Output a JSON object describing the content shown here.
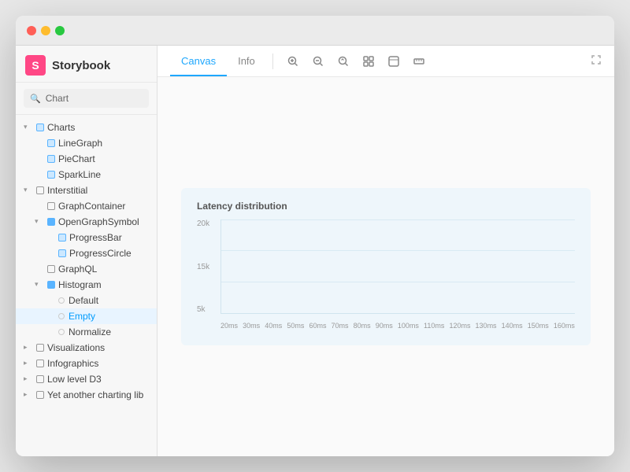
{
  "window": {
    "title": "Storybook"
  },
  "sidebar": {
    "logo_letter": "S",
    "title": "Storybook",
    "search_placeholder": "Chart",
    "items": [
      {
        "id": "charts",
        "label": "Charts",
        "indent": 1,
        "type": "group",
        "expanded": true
      },
      {
        "id": "linegraph",
        "label": "LineGraph",
        "indent": 2,
        "type": "leaf"
      },
      {
        "id": "piechart",
        "label": "PieChart",
        "indent": 2,
        "type": "leaf"
      },
      {
        "id": "sparkline",
        "label": "SparkLine",
        "indent": 2,
        "type": "leaf"
      },
      {
        "id": "interstitial",
        "label": "Interstitial",
        "indent": 1,
        "type": "group",
        "expanded": true
      },
      {
        "id": "graphcontainer",
        "label": "GraphContainer",
        "indent": 2,
        "type": "leaf"
      },
      {
        "id": "opengraphsymbol",
        "label": "OpenGraphSymbol",
        "indent": 2,
        "type": "group",
        "expanded": true
      },
      {
        "id": "progressbar",
        "label": "ProgressBar",
        "indent": 3,
        "type": "leaf"
      },
      {
        "id": "progresscircle",
        "label": "ProgressCircle",
        "indent": 3,
        "type": "leaf"
      },
      {
        "id": "graphql",
        "label": "GraphQL",
        "indent": 2,
        "type": "leaf"
      },
      {
        "id": "histogram",
        "label": "Histogram",
        "indent": 2,
        "type": "group",
        "expanded": true
      },
      {
        "id": "default",
        "label": "Default",
        "indent": 3,
        "type": "story"
      },
      {
        "id": "empty",
        "label": "Empty",
        "indent": 3,
        "type": "story",
        "active": true
      },
      {
        "id": "normalize",
        "label": "Normalize",
        "indent": 3,
        "type": "story"
      },
      {
        "id": "visualizations",
        "label": "Visualizations",
        "indent": 1,
        "type": "group"
      },
      {
        "id": "infographics",
        "label": "Infographics",
        "indent": 1,
        "type": "group"
      },
      {
        "id": "lowleveld3",
        "label": "Low level D3",
        "indent": 1,
        "type": "group"
      },
      {
        "id": "yetanother",
        "label": "Yet another charting lib",
        "indent": 1,
        "type": "group"
      }
    ]
  },
  "toolbar": {
    "tabs": [
      {
        "id": "canvas",
        "label": "Canvas",
        "active": true
      },
      {
        "id": "info",
        "label": "Info",
        "active": false
      }
    ],
    "icons": [
      {
        "id": "zoom-in",
        "symbol": "⊕",
        "label": "Zoom In"
      },
      {
        "id": "zoom-out",
        "symbol": "⊖",
        "label": "Zoom Out"
      },
      {
        "id": "zoom-reset",
        "symbol": "⊙",
        "label": "Reset Zoom"
      },
      {
        "id": "grid",
        "symbol": "⊞",
        "label": "Grid"
      },
      {
        "id": "background",
        "symbol": "◱",
        "label": "Background"
      },
      {
        "id": "measure",
        "symbol": "⊟",
        "label": "Measure"
      }
    ],
    "expand_icon": "⤢"
  },
  "chart": {
    "title": "Latency distribution",
    "y_labels": [
      "20k",
      "15k",
      "5k"
    ],
    "x_labels": [
      "20ms",
      "30ms",
      "40ms",
      "50ms",
      "60ms",
      "70ms",
      "80ms",
      "90ms",
      "100ms",
      "110ms",
      "120ms",
      "130ms",
      "140ms",
      "150ms",
      "160ms"
    ]
  }
}
